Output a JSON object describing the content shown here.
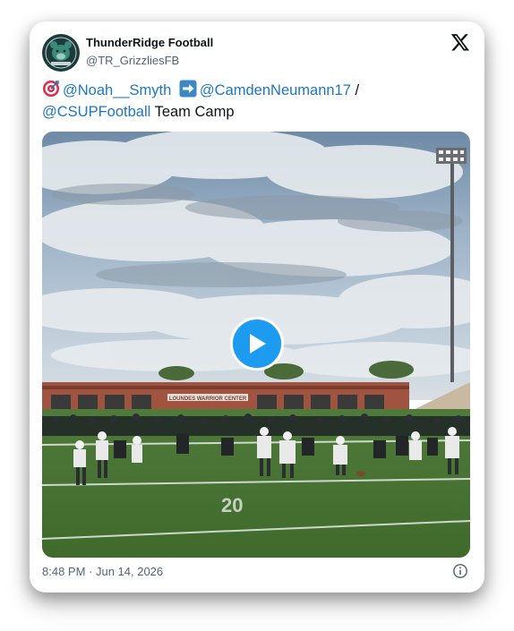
{
  "tweet": {
    "author_name": "ThunderRidge Football",
    "author_handle": "@TR_GrizzliesFB",
    "text": {
      "mention_1": "@Noah__Smyth",
      "mention_2": "@CamdenNeumann17",
      "separator": " /",
      "mention_3": "@CSUPFootball",
      "tail": " Team Camp"
    },
    "media": {
      "type": "video",
      "building_sign": "LOUNDES WARRIOR CENTER",
      "field_marking": "20"
    },
    "timestamp": "8:48 PM · Jun 14, 2026"
  },
  "icons": {
    "logo": "x-logo-icon",
    "target_emoji": "target-emoji-icon",
    "arrow_emoji": "right-arrow-emoji-icon",
    "play": "play-icon",
    "info": "info-icon"
  },
  "colors": {
    "mention": "#1d77c2",
    "play_button": "#1d9bf0",
    "text": "#0f1419",
    "muted": "#536471"
  }
}
